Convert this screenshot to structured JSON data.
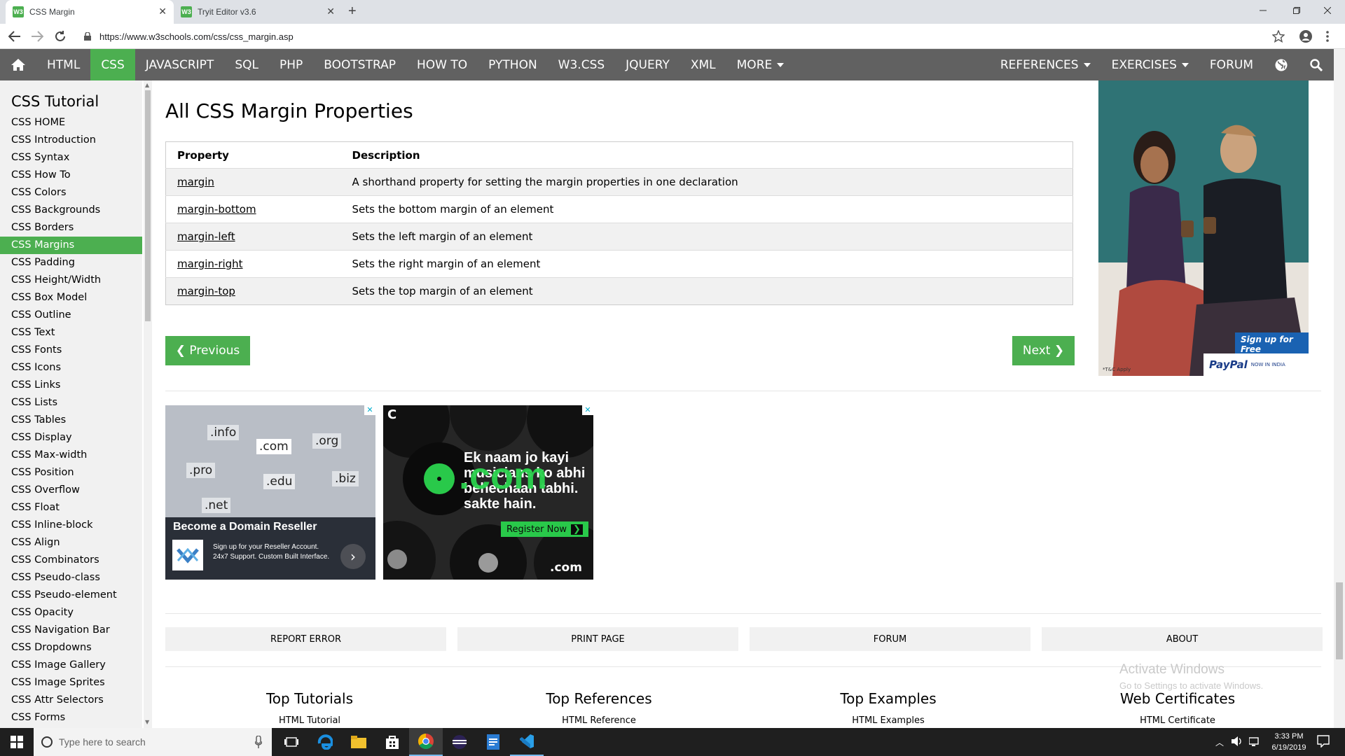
{
  "browser": {
    "tabs": [
      {
        "title": "CSS Margin",
        "favicon": "w3"
      },
      {
        "title": "Tryit Editor v3.6",
        "favicon": "w3"
      }
    ],
    "url": "https://www.w3schools.com/css/css_margin.asp"
  },
  "topnav": {
    "items": [
      "HTML",
      "CSS",
      "JAVASCRIPT",
      "SQL",
      "PHP",
      "BOOTSTRAP",
      "HOW TO",
      "PYTHON",
      "W3.CSS",
      "JQUERY",
      "XML",
      "MORE"
    ],
    "active": "CSS",
    "right_items": [
      "REFERENCES",
      "EXERCISES",
      "FORUM"
    ]
  },
  "sidebar": {
    "title": "CSS Tutorial",
    "items": [
      "CSS HOME",
      "CSS Introduction",
      "CSS Syntax",
      "CSS How To",
      "CSS Colors",
      "CSS Backgrounds",
      "CSS Borders",
      "CSS Margins",
      "CSS Padding",
      "CSS Height/Width",
      "CSS Box Model",
      "CSS Outline",
      "CSS Text",
      "CSS Fonts",
      "CSS Icons",
      "CSS Links",
      "CSS Lists",
      "CSS Tables",
      "CSS Display",
      "CSS Max-width",
      "CSS Position",
      "CSS Overflow",
      "CSS Float",
      "CSS Inline-block",
      "CSS Align",
      "CSS Combinators",
      "CSS Pseudo-class",
      "CSS Pseudo-element",
      "CSS Opacity",
      "CSS Navigation Bar",
      "CSS Dropdowns",
      "CSS Image Gallery",
      "CSS Image Sprites",
      "CSS Attr Selectors",
      "CSS Forms"
    ],
    "selected": "CSS Margins"
  },
  "main": {
    "title": "All CSS Margin Properties",
    "table": {
      "headers": [
        "Property",
        "Description"
      ],
      "rows": [
        [
          "margin",
          "A shorthand property for setting the margin properties in one declaration"
        ],
        [
          "margin-bottom",
          "Sets the bottom margin of an element"
        ],
        [
          "margin-left",
          "Sets the left margin of an element"
        ],
        [
          "margin-right",
          "Sets the right margin of an element"
        ],
        [
          "margin-top",
          "Sets the top margin of an element"
        ]
      ]
    },
    "prev_label": "❮ Previous",
    "next_label": "Next ❯"
  },
  "ads": {
    "domain": {
      "tlds": [
        ".info",
        ".com",
        ".org",
        ".pro",
        ".edu",
        ".biz",
        ".net"
      ],
      "headline": "Become a Domain Reseller",
      "body": "Sign up for your Reseller Account. 24x7 Support. Custom Built Interface."
    },
    "music": {
      "big_text": ".com",
      "line1": "Ek naam jo kayi",
      "line2": "musicians ko abhi",
      "line3": "behechaan tabhi.",
      "line4": "sakte hain.",
      "cta": "Register Now",
      "footer": ".com",
      "corner_logo": "C"
    },
    "paypal": {
      "cta": "Sign up for Free",
      "brand": "PayPal",
      "tagline": "NOW IN INDIA",
      "fine": "*T&C Apply"
    }
  },
  "footer": {
    "buttons": [
      "REPORT ERROR",
      "PRINT PAGE",
      "FORUM",
      "ABOUT"
    ],
    "columns": [
      {
        "heading": "Top Tutorials",
        "link": "HTML Tutorial"
      },
      {
        "heading": "Top References",
        "link": "HTML Reference"
      },
      {
        "heading": "Top Examples",
        "link": "HTML Examples"
      },
      {
        "heading": "Web Certificates",
        "link": "HTML Certificate"
      }
    ]
  },
  "watermark": {
    "title": "Activate Windows",
    "subtitle": "Go to Settings to activate Windows."
  },
  "taskbar": {
    "search_placeholder": "Type here to search",
    "time": "3:33 PM",
    "date": "6/19/2019"
  },
  "colors": {
    "w3_green": "#4caf50",
    "nav_gray": "#616161",
    "sidebar_bg": "#f1f1f1",
    "taskbar": "#1f1f1f"
  }
}
